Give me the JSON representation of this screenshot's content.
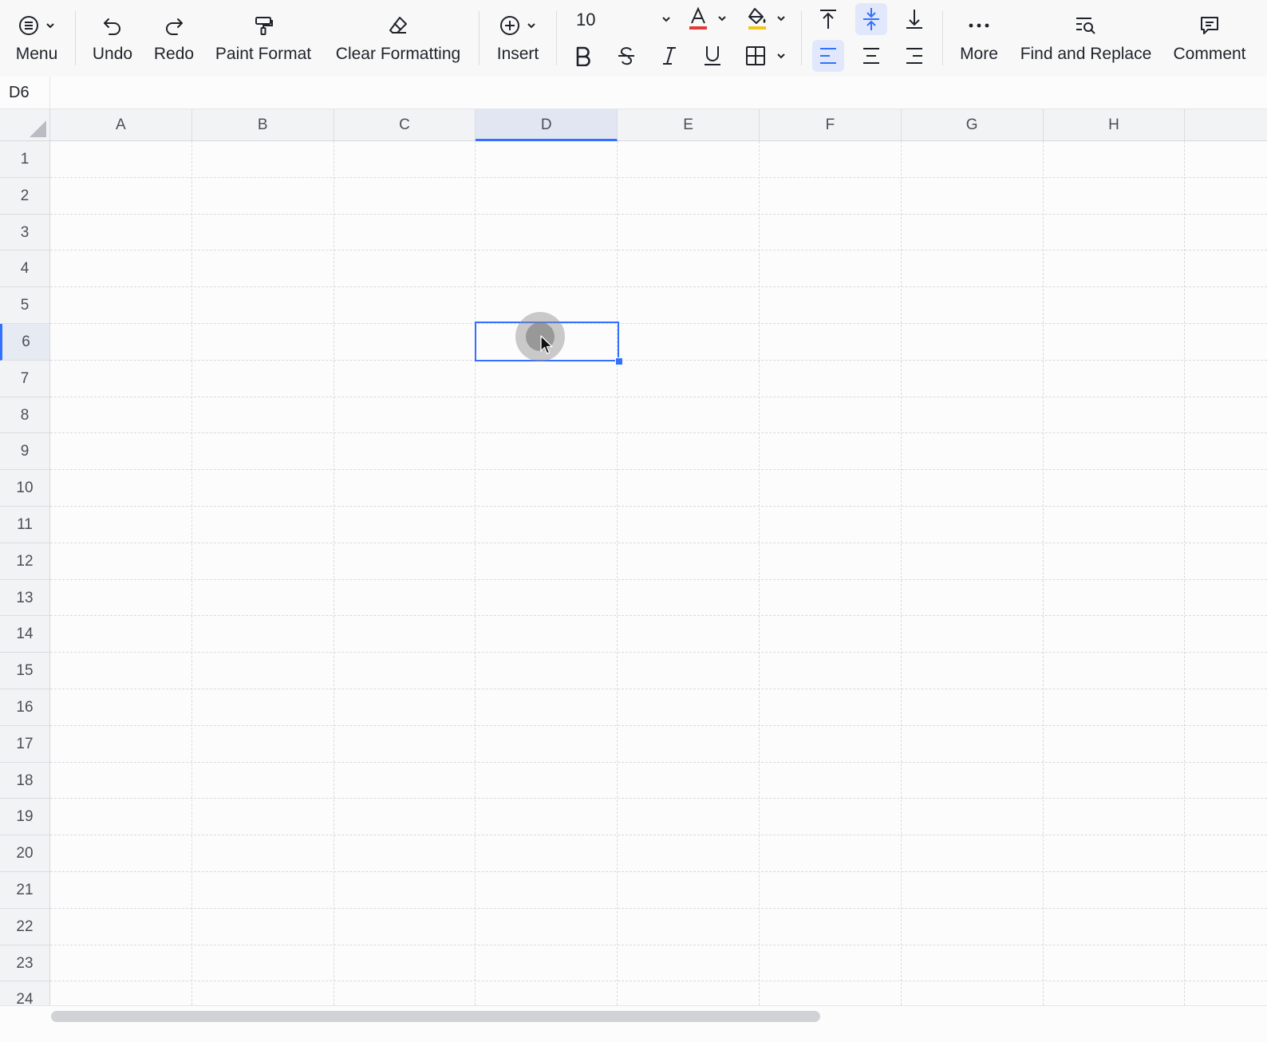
{
  "toolbar": {
    "menu_label": "Menu",
    "undo_label": "Undo",
    "redo_label": "Redo",
    "paint_format_label": "Paint Format",
    "clear_formatting_label": "Clear Formatting",
    "insert_label": "Insert",
    "font_size": "10",
    "more_label": "More",
    "find_replace_label": "Find and Replace",
    "comment_label": "Comment",
    "font_color": "#e53935",
    "fill_color": "#f5c518",
    "accent": "#3370ff",
    "active_vertical_align": "middle",
    "active_horizontal_align": "left"
  },
  "namebox": {
    "cell_ref": "D6"
  },
  "grid": {
    "columns": [
      "A",
      "B",
      "C",
      "D",
      "E",
      "F",
      "G",
      "H"
    ],
    "rows": [
      "1",
      "2",
      "3",
      "4",
      "5",
      "6",
      "7",
      "8",
      "9",
      "10",
      "11",
      "12",
      "13",
      "14",
      "15",
      "16",
      "17",
      "18",
      "19",
      "20",
      "21",
      "22",
      "23",
      "24"
    ],
    "selected_column": "D",
    "selected_row": "6",
    "selected_cell": "D6"
  }
}
